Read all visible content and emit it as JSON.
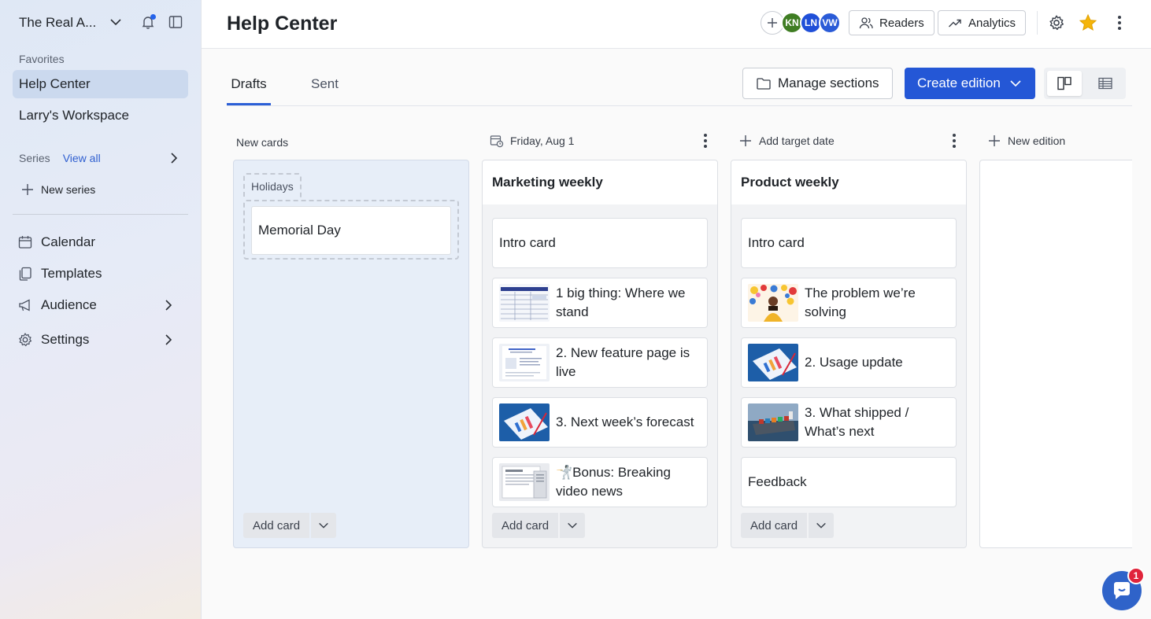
{
  "sidebar": {
    "workspace_name": "The Real A...",
    "favorites_label": "Favorites",
    "favorites": [
      {
        "label": "Help Center",
        "active": true
      },
      {
        "label": "Larry's Workspace",
        "active": false
      }
    ],
    "series_label": "Series",
    "view_all_label": "View all",
    "new_series_label": "New series",
    "nav": [
      {
        "label": "Calendar",
        "icon": "calendar-icon"
      },
      {
        "label": "Templates",
        "icon": "templates-icon"
      },
      {
        "label": "Audience",
        "icon": "megaphone-icon"
      },
      {
        "label": "Settings",
        "icon": "gear-icon"
      }
    ]
  },
  "header": {
    "title": "Help Center",
    "avatars": [
      {
        "initials": "KN",
        "color": "#3f7d23"
      },
      {
        "initials": "LN",
        "color": "#1f4fd8"
      },
      {
        "initials": "VW",
        "color": "#2a5bd7"
      }
    ],
    "readers_label": "Readers",
    "analytics_label": "Analytics"
  },
  "tabs": [
    {
      "label": "Drafts",
      "active": true
    },
    {
      "label": "Sent",
      "active": false
    }
  ],
  "toolbar": {
    "manage_sections_label": "Manage sections",
    "create_edition_label": "Create edition"
  },
  "columns": {
    "new_cards": {
      "header": "New cards",
      "group_label": "Holidays",
      "cards": [
        "Memorial Day"
      ],
      "add_card_label": "Add card"
    },
    "marketing": {
      "date_label": "Friday, Aug 1",
      "title": "Marketing weekly",
      "cards": [
        {
          "title": "Intro card",
          "thumb": null
        },
        {
          "title": "1 big thing: Where we stand",
          "thumb": "table"
        },
        {
          "title": "2. New feature page is live",
          "thumb": "doc"
        },
        {
          "title": "3. Next week’s forecast",
          "thumb": "chart"
        },
        {
          "title": "🤺Bonus: Breaking video news",
          "thumb": "newspaper"
        }
      ],
      "add_card_label": "Add card"
    },
    "product": {
      "date_label": "Add target date",
      "title": "Product weekly",
      "cards": [
        {
          "title": "Intro card",
          "thumb": null
        },
        {
          "title": "The problem we’re solving",
          "thumb": "emoji"
        },
        {
          "title": "2. Usage update",
          "thumb": "chart"
        },
        {
          "title": "3. What shipped / What’s next",
          "thumb": "ship"
        },
        {
          "title": "Feedback",
          "thumb": null
        }
      ],
      "add_card_label": "Add card"
    },
    "new_edition_label": "New edition"
  },
  "help_badge_count": "1",
  "colors": {
    "accent": "#2457d6",
    "active_nav": "#cbd9ee",
    "star": "#f5b50a"
  }
}
